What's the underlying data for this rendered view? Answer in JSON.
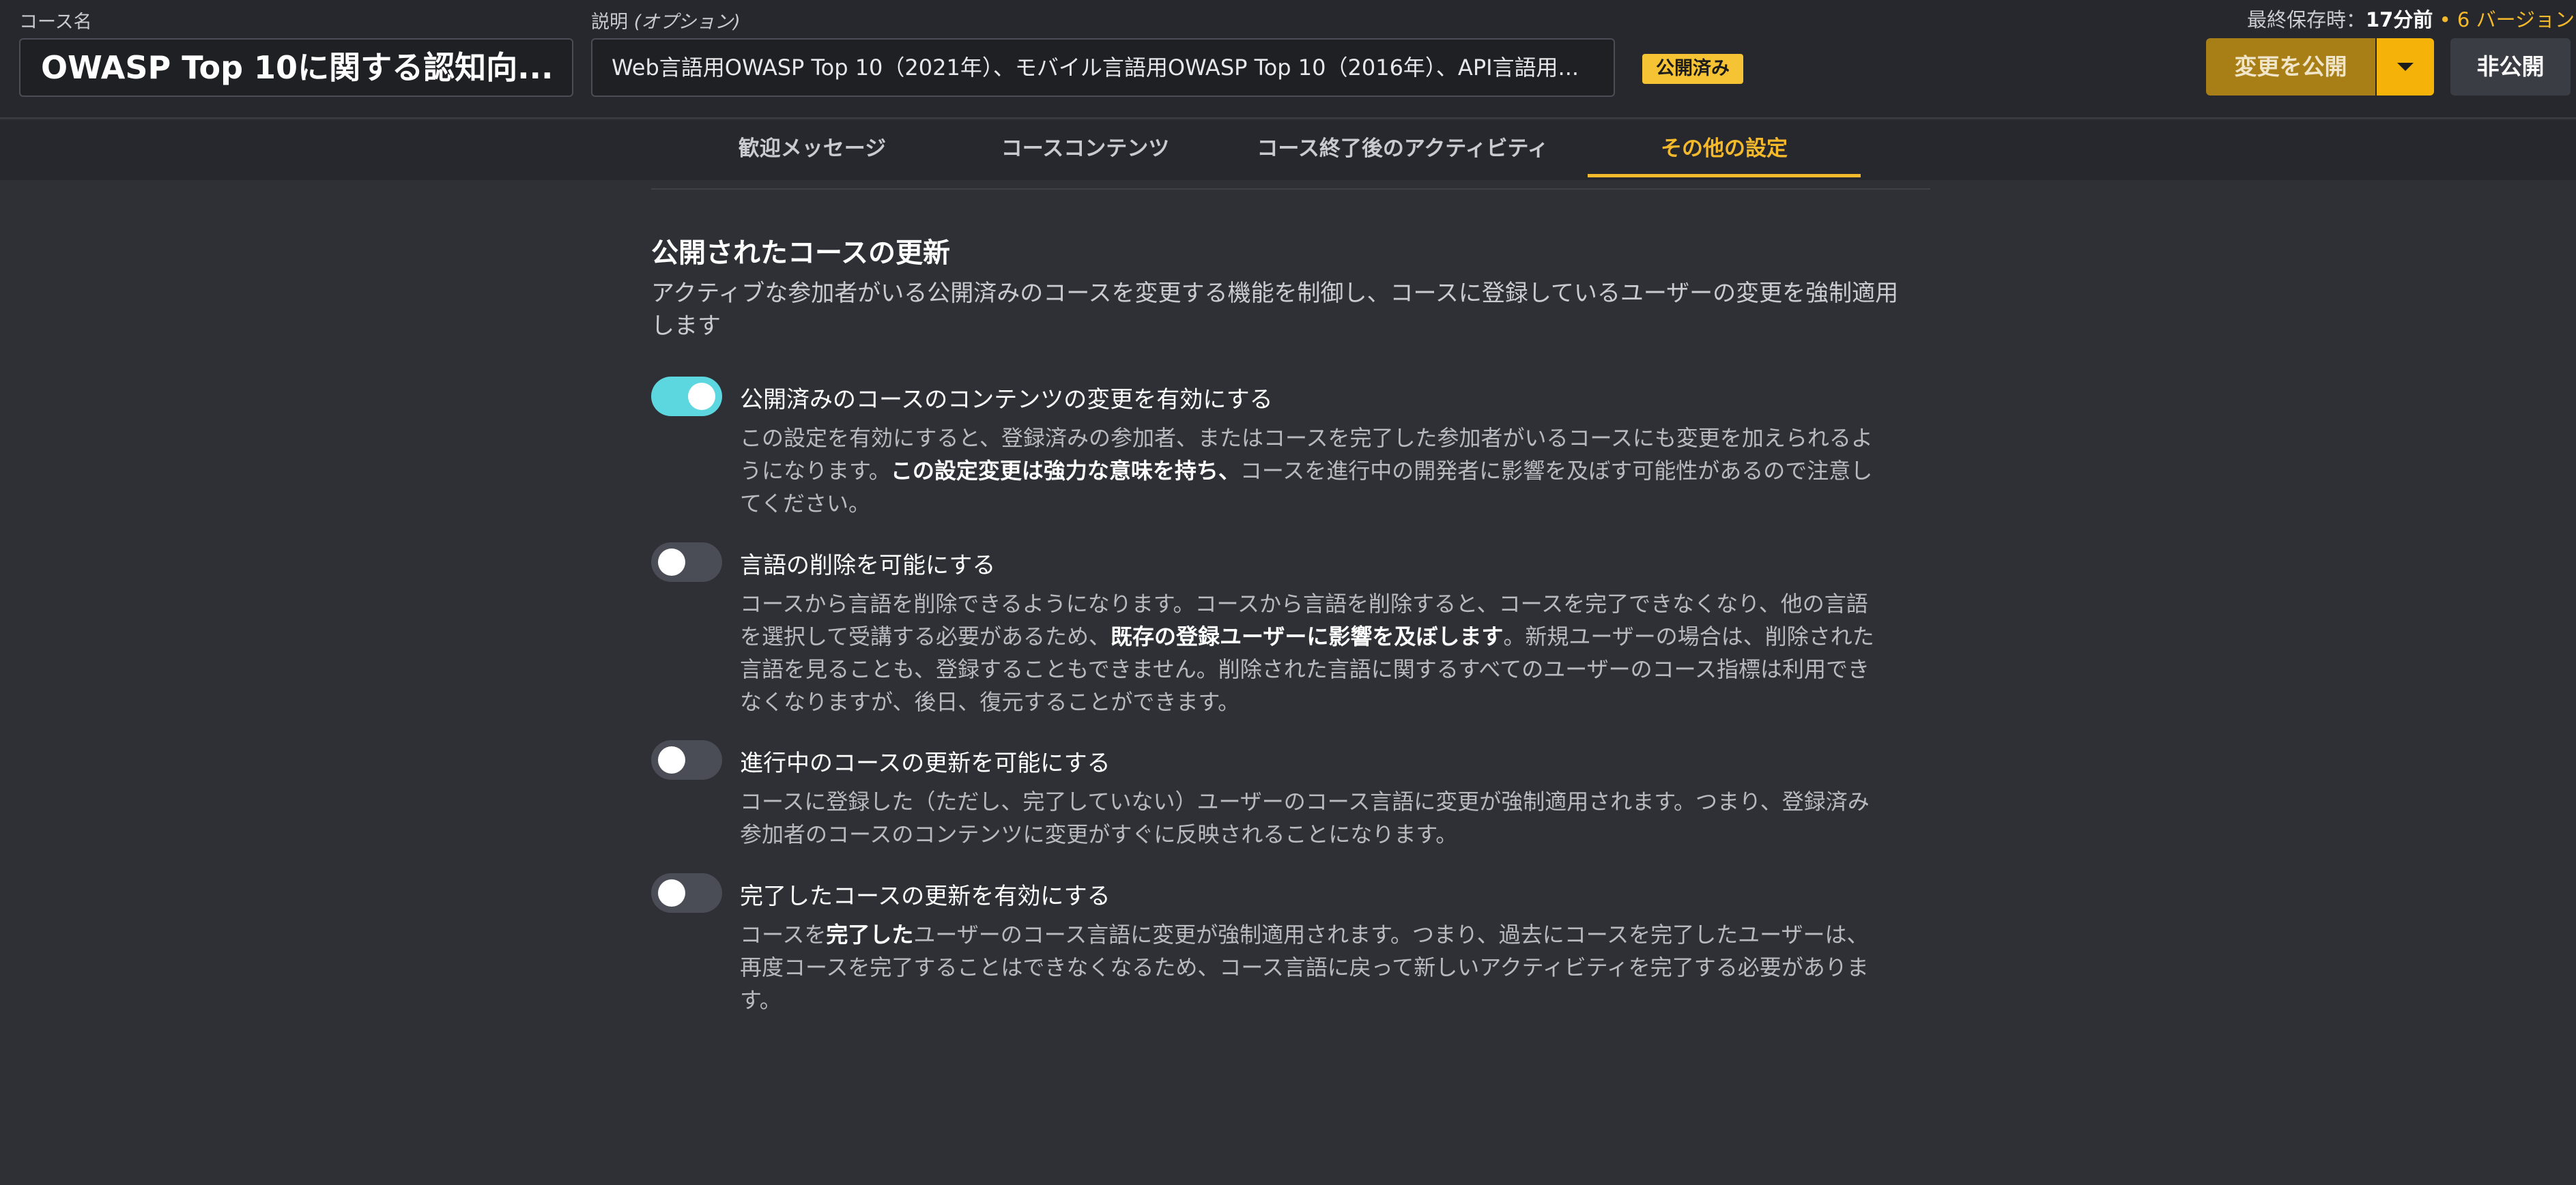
{
  "header": {
    "course_name_label": "コース名",
    "course_name": "OWASP Top 10に関する認知向...",
    "description_label": "説明",
    "description_optional": "(オプション)",
    "description": "Web言語用OWASP Top 10（2021年）、モバイル言語用OWASP Top 10（2016年）、API言語用...",
    "status_badge": "公開済み",
    "last_saved_label": "最終保存時：",
    "last_saved_value": "17分前",
    "separator": " • ",
    "versions": "6 バージョン",
    "publish_button": "変更を公開",
    "unpublish_button": "非公開"
  },
  "tabs": [
    {
      "label": "歓迎メッセージ",
      "active": false
    },
    {
      "label": "コースコンテンツ",
      "active": false
    },
    {
      "label": "コース終了後のアクティビティ",
      "active": false
    },
    {
      "label": "その他の設定",
      "active": true
    }
  ],
  "section": {
    "title": "公開されたコースの更新",
    "description": "アクティブな参加者がいる公開済みのコースを変更する機能を制御し、コースに登録しているユーザーの変更を強制適用します"
  },
  "settings": [
    {
      "title": "公開済みのコースのコンテンツの変更を有効にする",
      "enabled": true,
      "desc_1": "この設定を有効にすると、登録済みの参加者、またはコースを完了した参加者がいるコースにも変更を加えられるようになります。",
      "desc_bold": "この設定変更は強力な意味を持ち、",
      "desc_2": "コースを進行中の開発者に影響を及ぼす可能性があるので注意してください。"
    },
    {
      "title": "言語の削除を可能にする",
      "enabled": false,
      "desc_1": "コースから言語を削除できるようになります。コースから言語を削除すると、コースを完了できなくなり、他の言語を選択して受講する必要があるため、",
      "desc_bold": "既存の登録ユーザーに影響を及ぼします",
      "desc_2": "。新規ユーザーの場合は、削除された言語を見ることも、登録することもできません。削除された言語に関するすべてのユーザーのコース指標は利用できなくなりますが、後日、復元することができます。"
    },
    {
      "title": "進行中のコースの更新を可能にする",
      "enabled": false,
      "desc_1": "コースに登録した（ただし、完了していない）ユーザーのコース言語に変更が強制適用されます。つまり、登録済み参加者のコースのコンテンツに変更がすぐに反映されることになります。"
    },
    {
      "title": "完了したコースの更新を有効にする",
      "enabled": false,
      "desc_1": "コースを",
      "desc_bold": "完了した",
      "desc_2": "ユーザーのコース言語に変更が強制適用されます。つまり、過去にコースを完了したユーザーは、再度コースを完了することはできなくなるため、コース言語に戻って新しいアクティビティを完了する必要があります。"
    }
  ]
}
